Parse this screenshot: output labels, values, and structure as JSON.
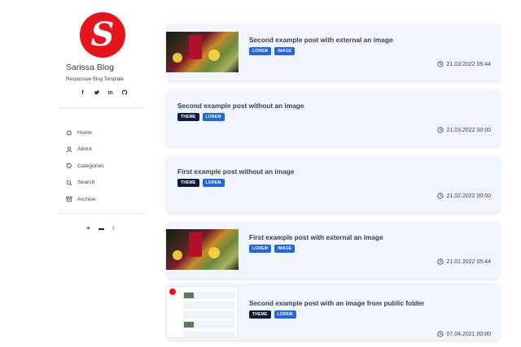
{
  "sidebar": {
    "logo_letter": "S",
    "title": "Sarissa Blog",
    "subtitle": "Responsive Blog Template",
    "social": [
      {
        "icon": "facebook-icon",
        "glyph": "f"
      },
      {
        "icon": "twitter-icon",
        "glyph": "t"
      },
      {
        "icon": "linkedin-icon",
        "glyph": "in"
      },
      {
        "icon": "github-icon",
        "glyph": "g"
      }
    ],
    "nav": [
      {
        "label": "Home",
        "icon": "home-icon"
      },
      {
        "label": "About",
        "icon": "user-icon"
      },
      {
        "label": "Categories",
        "icon": "tag-icon"
      },
      {
        "label": "Search",
        "icon": "search-icon"
      },
      {
        "label": "Archive",
        "icon": "archive-icon"
      }
    ],
    "theme_buttons": [
      {
        "icon": "sun-icon",
        "glyph": "☀"
      },
      {
        "icon": "laptop-icon",
        "glyph": "▬"
      },
      {
        "icon": "moon-icon",
        "glyph": "☾"
      }
    ]
  },
  "posts": [
    {
      "title": "Second example post with external an image",
      "tags": [
        "LOREM",
        "IMAGE"
      ],
      "date": "21.03.2022 05:44",
      "thumbnail": "photo"
    },
    {
      "title": "Second example post without an image",
      "tags": [
        "THEME",
        "LOREM"
      ],
      "date": "21.03.2022 00:00",
      "thumbnail": "none"
    },
    {
      "title": "First example post without an image",
      "tags": [
        "THEME",
        "LOREM"
      ],
      "date": "21.02.2022 00:00",
      "thumbnail": "none"
    },
    {
      "title": "First example post with external an image",
      "tags": [
        "LOREM",
        "IMAGE"
      ],
      "date": "21.01.2022 05:44",
      "thumbnail": "photo"
    },
    {
      "title": "Second example post with an image from public folder",
      "tags": [
        "THEME",
        "LOREM"
      ],
      "date": "07.04.2021 00:00",
      "thumbnail": "screenshot"
    }
  ],
  "colors": {
    "brand": "#e8141b",
    "card_bg": "#f0f5ff",
    "tag_theme": "#0f1b3d",
    "tag_accent": "#2563eb"
  }
}
